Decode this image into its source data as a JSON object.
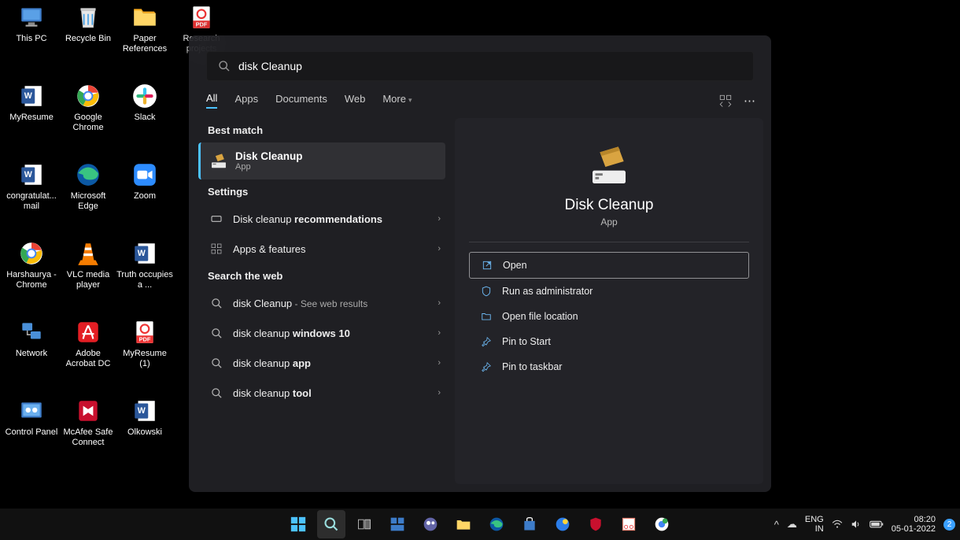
{
  "desktop_icons": [
    {
      "label": "This PC",
      "row": 0,
      "col": 0,
      "glyph": "pc"
    },
    {
      "label": "Recycle Bin",
      "row": 0,
      "col": 1,
      "glyph": "bin"
    },
    {
      "label": "Paper References",
      "row": 0,
      "col": 2,
      "glyph": "folder"
    },
    {
      "label": "Research projects",
      "row": 0,
      "col": 3,
      "glyph": "pdf"
    },
    {
      "label": "MyResume",
      "row": 1,
      "col": 0,
      "glyph": "word"
    },
    {
      "label": "Google Chrome",
      "row": 1,
      "col": 1,
      "glyph": "chrome"
    },
    {
      "label": "Slack",
      "row": 1,
      "col": 2,
      "glyph": "slack"
    },
    {
      "label": "congratulat... mail",
      "row": 2,
      "col": 0,
      "glyph": "word"
    },
    {
      "label": "Microsoft Edge",
      "row": 2,
      "col": 1,
      "glyph": "edge"
    },
    {
      "label": "Zoom",
      "row": 2,
      "col": 2,
      "glyph": "zoom"
    },
    {
      "label": "Harshaurya - Chrome",
      "row": 3,
      "col": 0,
      "glyph": "chrome"
    },
    {
      "label": "VLC media player",
      "row": 3,
      "col": 1,
      "glyph": "vlc"
    },
    {
      "label": "Truth occupies a ...",
      "row": 3,
      "col": 2,
      "glyph": "word"
    },
    {
      "label": "Network",
      "row": 4,
      "col": 0,
      "glyph": "network"
    },
    {
      "label": "Adobe Acrobat DC",
      "row": 4,
      "col": 1,
      "glyph": "acrobat"
    },
    {
      "label": "MyResume (1)",
      "row": 4,
      "col": 2,
      "glyph": "pdf"
    },
    {
      "label": "Control Panel",
      "row": 5,
      "col": 0,
      "glyph": "cpl"
    },
    {
      "label": "McAfee Safe Connect",
      "row": 5,
      "col": 1,
      "glyph": "mcafee"
    },
    {
      "label": "Olkowski",
      "row": 5,
      "col": 2,
      "glyph": "word"
    }
  ],
  "search": {
    "value": "disk Cleanup"
  },
  "tabs": [
    "All",
    "Apps",
    "Documents",
    "Web",
    "More"
  ],
  "best_match": {
    "title": "Disk Cleanup",
    "subtitle": "App"
  },
  "settings_head": "Settings",
  "settings": [
    {
      "text": "Disk cleanup ",
      "bold": "recommendations",
      "icon": "rect"
    },
    {
      "text": "Apps & features",
      "bold": "",
      "icon": "grid"
    }
  ],
  "web_head": "Search the web",
  "web": [
    {
      "pre": "disk Cleanup",
      "bold": "",
      "suffix": " - See web results"
    },
    {
      "pre": "disk cleanup ",
      "bold": "windows 10",
      "suffix": ""
    },
    {
      "pre": "disk cleanup ",
      "bold": "app",
      "suffix": ""
    },
    {
      "pre": "disk cleanup ",
      "bold": "tool",
      "suffix": ""
    }
  ],
  "preview": {
    "title": "Disk Cleanup",
    "subtitle": "App"
  },
  "actions": [
    {
      "label": "Open",
      "primary": true,
      "icon": "open"
    },
    {
      "label": "Run as administrator",
      "primary": false,
      "icon": "shield"
    },
    {
      "label": "Open file location",
      "primary": false,
      "icon": "folder"
    },
    {
      "label": "Pin to Start",
      "primary": false,
      "icon": "pin"
    },
    {
      "label": "Pin to taskbar",
      "primary": false,
      "icon": "pin"
    }
  ],
  "best_match_head": "Best match",
  "systray": {
    "lang1": "ENG",
    "lang2": "IN",
    "time": "08:20",
    "date": "05-01-2022",
    "notif": "2"
  }
}
